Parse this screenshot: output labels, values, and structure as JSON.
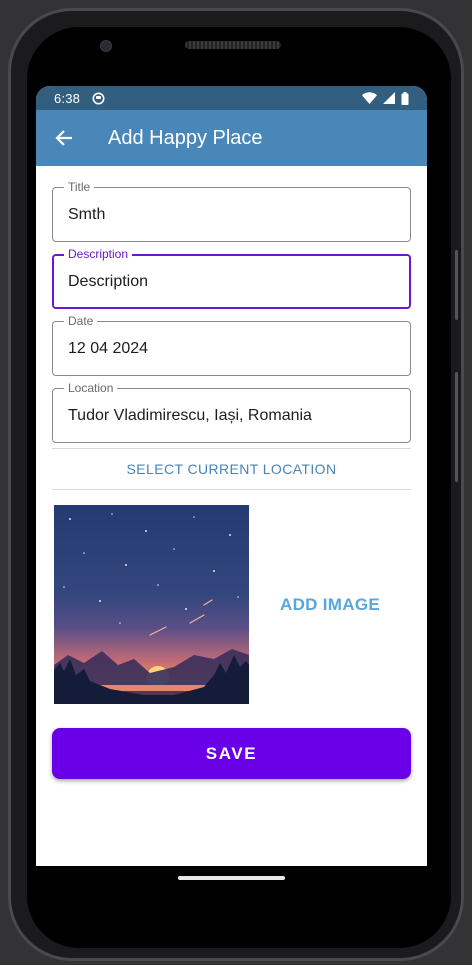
{
  "status_bar": {
    "time": "6:38"
  },
  "app_bar": {
    "title": "Add Happy Place"
  },
  "form": {
    "title": {
      "label": "Title",
      "value": "Smth"
    },
    "description": {
      "label": "Description",
      "value": "Description"
    },
    "date": {
      "label": "Date",
      "value": "12 04 2024"
    },
    "location": {
      "label": "Location",
      "value": "Tudor Vladimirescu, Iași, Romania"
    }
  },
  "select_location_label": "SELECT CURRENT LOCATION",
  "add_image_label": "ADD IMAGE",
  "save_label": "SAVE",
  "colors": {
    "app_bar": "#4987b8",
    "status_bar": "#325f80",
    "focus": "#6a17cf",
    "save_button": "#6a00e8",
    "link": "#4a84b4"
  }
}
